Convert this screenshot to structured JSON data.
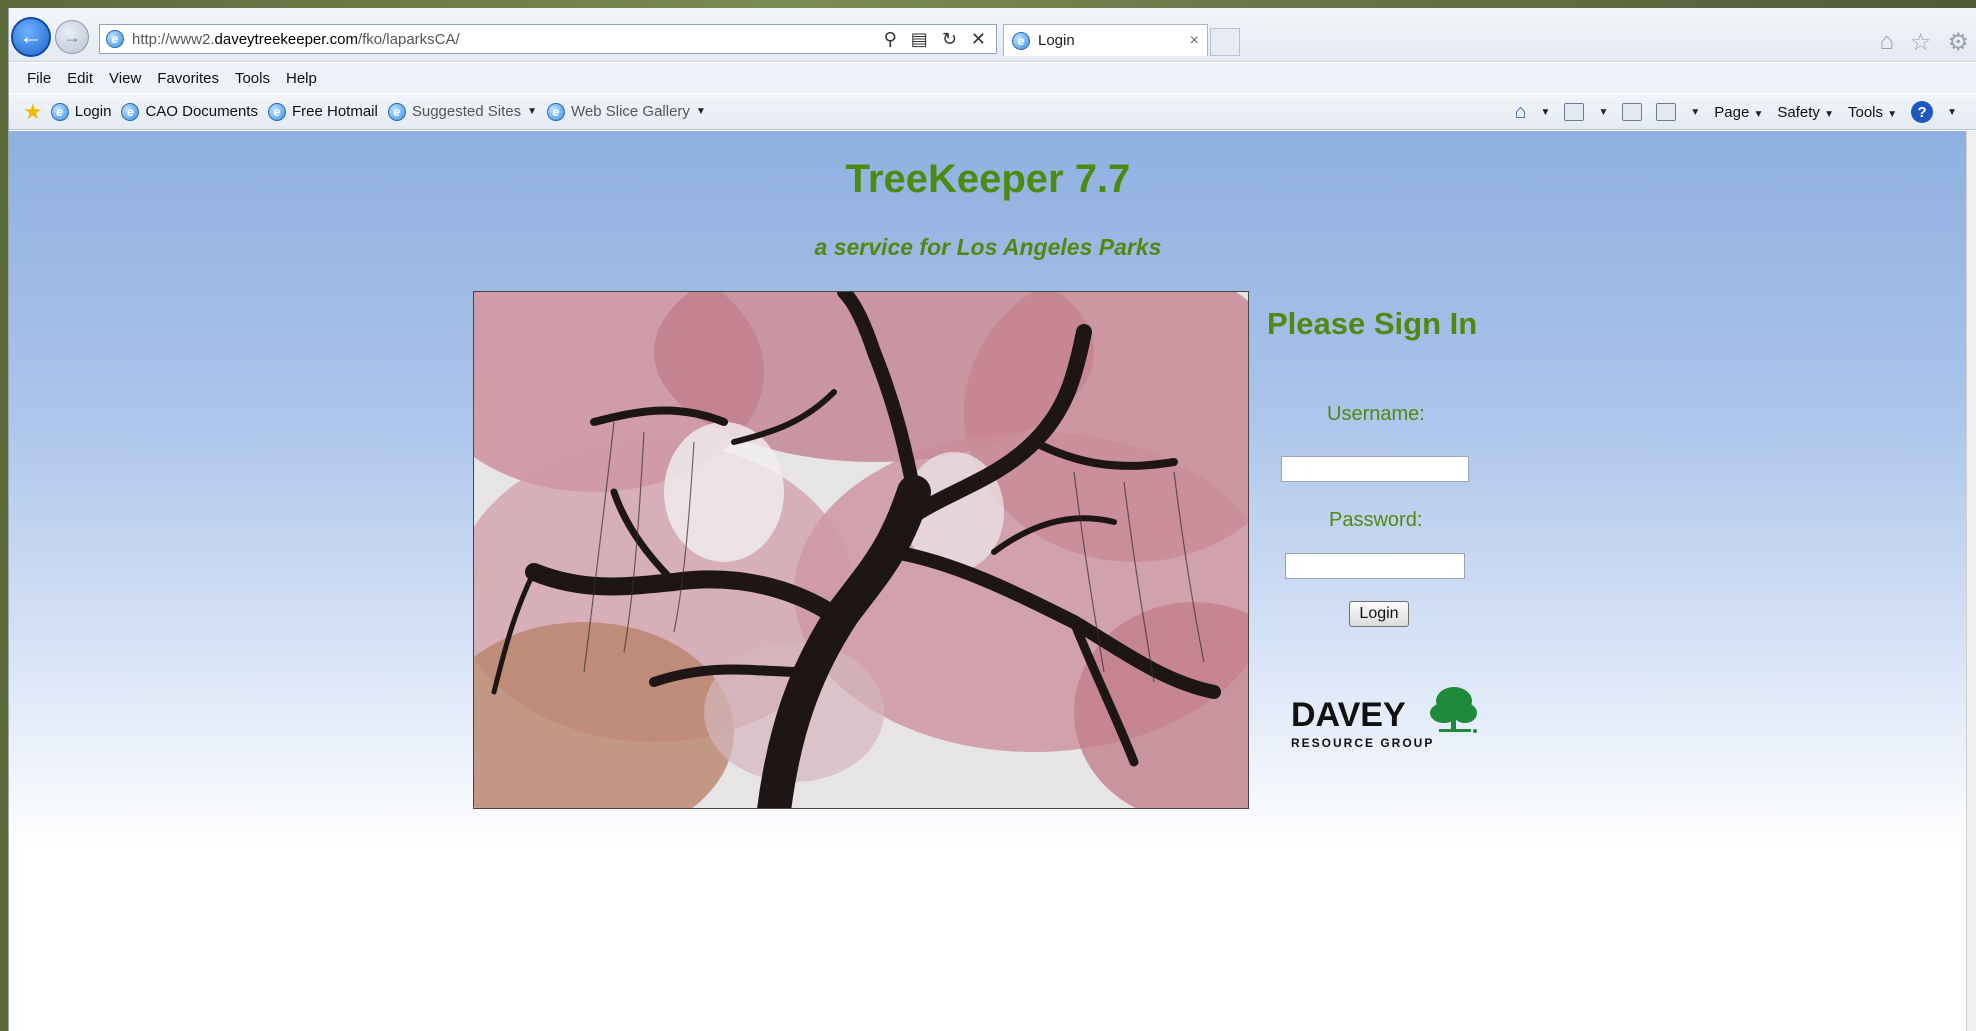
{
  "browser": {
    "url_prefix": "http://www2.",
    "url_domain": "daveytreekeeper.com",
    "url_path": "/fko/laparksCA/",
    "tab_title": "Login"
  },
  "menu": [
    "File",
    "Edit",
    "View",
    "Favorites",
    "Tools",
    "Help"
  ],
  "favorites": [
    {
      "label": "Login",
      "dim": false,
      "dropdown": false
    },
    {
      "label": "CAO Documents",
      "dim": false,
      "dropdown": false
    },
    {
      "label": "Free Hotmail",
      "dim": false,
      "dropdown": false
    },
    {
      "label": "Suggested Sites",
      "dim": true,
      "dropdown": true
    },
    {
      "label": "Web Slice Gallery",
      "dim": true,
      "dropdown": true
    }
  ],
  "command_bar": {
    "page_label": "Page",
    "safety_label": "Safety",
    "tools_label": "Tools"
  },
  "page": {
    "title": "TreeKeeper 7.7",
    "subtitle": "a service for Los Angeles Parks",
    "signin_title": "Please Sign In",
    "username_label": "Username:",
    "password_label": "Password:",
    "username_value": "",
    "password_value": "",
    "login_button": "Login",
    "logo_main": "DAVEY",
    "logo_sub": "RESOURCE GROUP"
  },
  "colors": {
    "heading_green": "#4f8a10",
    "logo_green": "#1e8a3a"
  }
}
